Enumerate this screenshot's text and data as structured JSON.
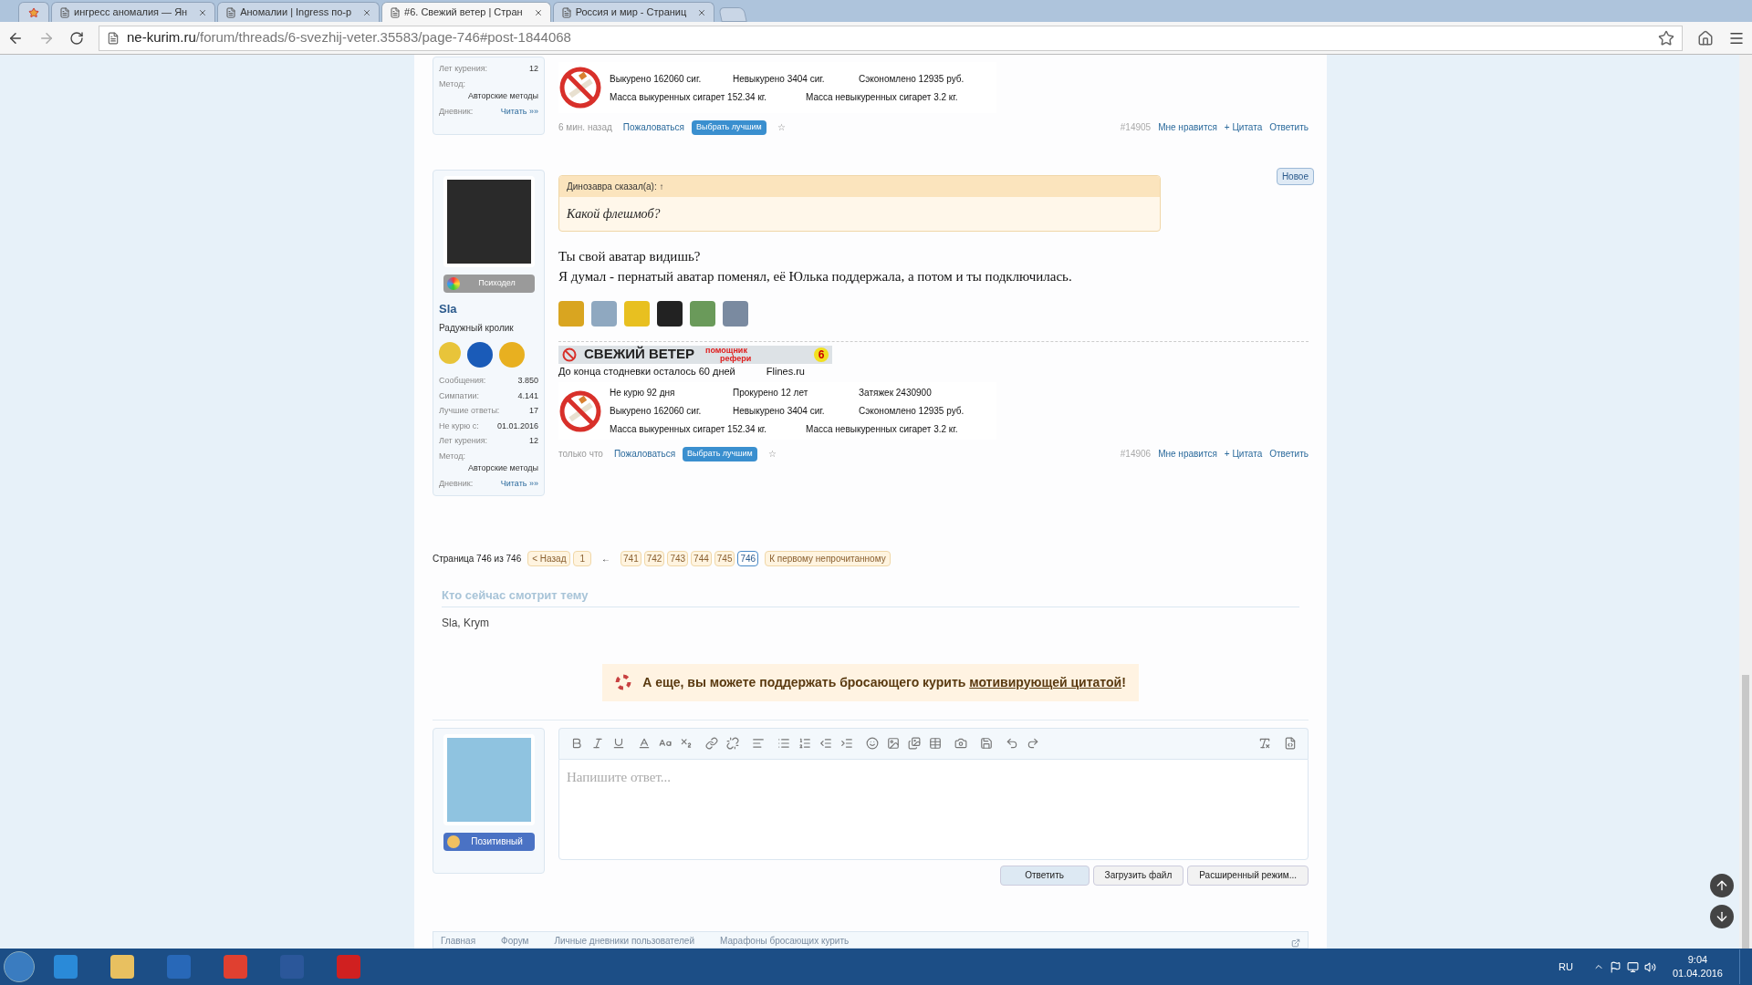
{
  "browser": {
    "tabs": [
      {
        "kind": "pinned",
        "selected": false
      },
      {
        "kind": "page",
        "title": "ингресс аномалия — Ян",
        "selected": false
      },
      {
        "kind": "page",
        "title": "Аномалии | Ingress по-р",
        "selected": false
      },
      {
        "kind": "page",
        "title": "#6. Свежий ветер | Стран",
        "selected": true
      },
      {
        "kind": "page",
        "title": "Россия и мир - Страниц",
        "selected": false
      }
    ],
    "url": {
      "host": "ne-kurim.ru",
      "path": "/forum/threads/6-svezhij-veter.35583/page-746#post-1844068"
    }
  },
  "posts": [
    {
      "user": {
        "stats": [
          {
            "kind": "pair",
            "label": "Лет курения:",
            "value": "12"
          },
          {
            "kind": "block",
            "label": "Метод:",
            "value": "Авторские методы"
          },
          {
            "kind": "link",
            "label": "Дневник:",
            "value": "Читать »»"
          }
        ]
      },
      "signature": {
        "rows": [
          [
            "Выкурено 162060 сиг.",
            "Невыкурено 3404 сиг.",
            "Сэкономлено 12935 руб."
          ],
          [
            "Масса выкуренных сигарет 152.34 кг.",
            "Масса невыкуренных сигарет 3.2 кг."
          ]
        ]
      },
      "footer": {
        "time": "6 мин. назад",
        "report": "Пожаловаться",
        "best": "Выбрать лучшим",
        "star": "☆",
        "number": "#14905",
        "like": "Мне нравится",
        "quote": "+ Цитата",
        "reply": "Ответить"
      }
    },
    {
      "new_badge": "Новое",
      "user": {
        "rank": "Психодел",
        "name": "Sla",
        "title": "Радужный кролик",
        "stats": [
          {
            "kind": "pair",
            "label": "Сообщения:",
            "value": "3.850"
          },
          {
            "kind": "pair",
            "label": "Симпатии:",
            "value": "4.141"
          },
          {
            "kind": "pair",
            "label": "Лучшие ответы:",
            "value": "17"
          },
          {
            "kind": "pair",
            "label": "Не курю с:",
            "value": "01.01.2016"
          },
          {
            "kind": "pair",
            "label": "Лет курения:",
            "value": "12"
          },
          {
            "kind": "block",
            "label": "Метод:",
            "value": "Авторские методы"
          },
          {
            "kind": "link",
            "label": "Дневник:",
            "value": "Читать »»"
          }
        ]
      },
      "quote": {
        "author": "Динозавра сказал(а): ↑",
        "text": "Какой флешмоб?"
      },
      "message": [
        "Ты свой аватар видишь?",
        "Я думал - пернатый аватар поменял, её Юлька поддержала, а потом и ты подключилась."
      ],
      "signature": {
        "banner": {
          "title": "СВЕЖИЙ ВЕТЕР",
          "subtitle": [
            "помощник",
            "рефери"
          ],
          "number": "6"
        },
        "countdown": "До конца стодневки осталось 60 дней",
        "site": "Flines.ru",
        "rows": [
          [
            "Не курю 92 дня",
            "Прокурено 12 лет",
            "Затяжек 2430900"
          ],
          [
            "Выкурено 162060 сиг.",
            "Невыкурено 3404 сиг.",
            "Сэкономлено 12935 руб."
          ],
          [
            "Масса выкуренных сигарет 152.34 кг.",
            "Масса невыкуренных сигарет 3.2 кг."
          ]
        ]
      },
      "footer": {
        "time": "только что",
        "report": "Пожаловаться",
        "best": "Выбрать лучшим",
        "star": "☆",
        "number": "#14906",
        "like": "Мне нравится",
        "quote": "+ Цитата",
        "reply": "Ответить"
      }
    }
  ],
  "pagination": {
    "label": "Страница 746 из 746",
    "prev": "< Назад",
    "first": "1",
    "gap": "←",
    "pages": [
      {
        "label": "741",
        "selected": false
      },
      {
        "label": "742",
        "selected": false
      },
      {
        "label": "743",
        "selected": false
      },
      {
        "label": "744",
        "selected": false
      },
      {
        "label": "745",
        "selected": false
      },
      {
        "label": "746",
        "selected": true
      }
    ],
    "unread": "К первому непрочитанному"
  },
  "viewers": {
    "title": "Кто сейчас смотрит тему",
    "names": "Sla, Krym"
  },
  "promo": {
    "text": "А еще, вы можете поддержать бросающего курить ",
    "link": "мотивирующей цитатой",
    "end": "!"
  },
  "editor": {
    "rank": "Позитивный",
    "placeholder": "Напишите ответ...",
    "buttons": [
      "Ответить",
      "Загрузить файл",
      "Расширенный режим..."
    ]
  },
  "footer_nav": [
    "Главная",
    "Форум",
    "Личные дневники пользователей",
    "Марафоны бросающих курить"
  ],
  "taskbar": {
    "language": "RU",
    "time": "9:04",
    "date": "01.04.2016"
  }
}
